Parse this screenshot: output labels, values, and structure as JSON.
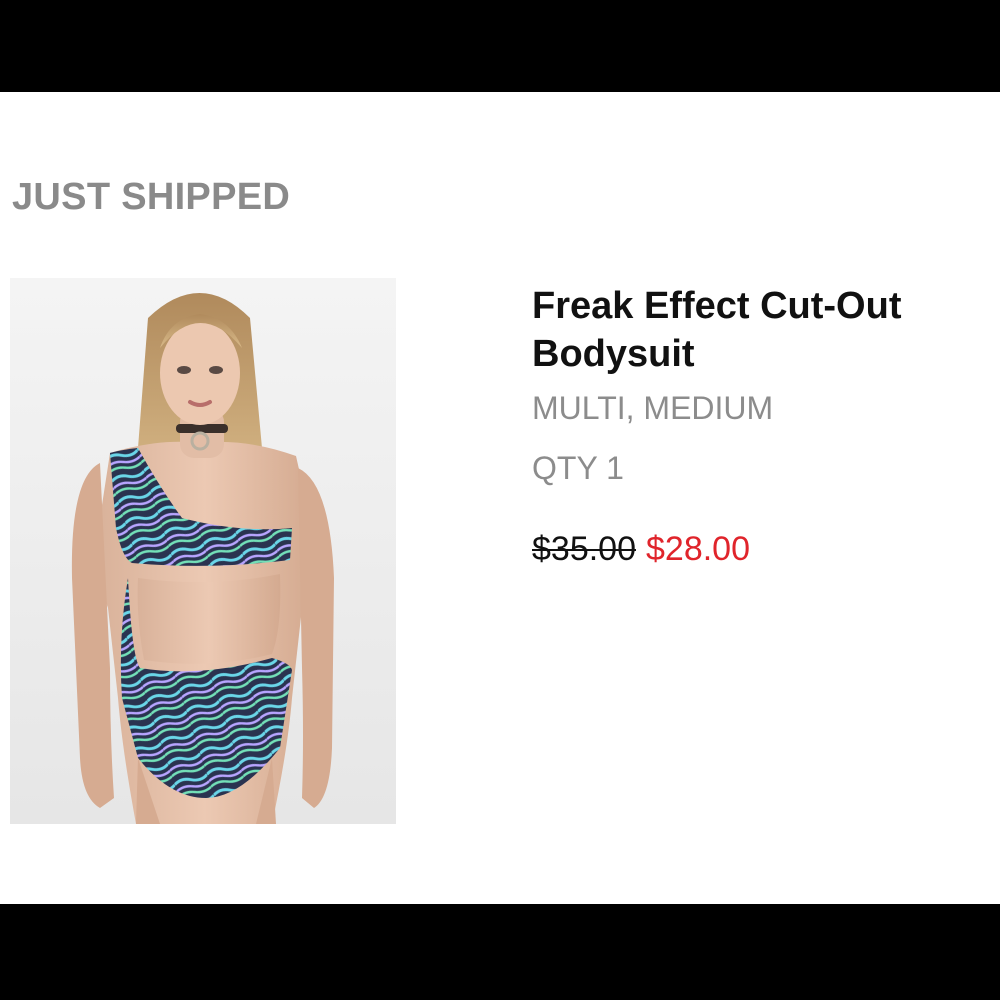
{
  "section": {
    "title": "JUST SHIPPED"
  },
  "product": {
    "name_line1": "Freak Effect Cut-Out",
    "name_line2": "Bodysuit",
    "variant": "MULTI, MEDIUM",
    "quantity": "QTY 1",
    "original_price": "$35.00",
    "sale_price": "$28.00"
  },
  "colors": {
    "sale_price": "#e0242b",
    "muted_text": "#8c8c8c",
    "letterbox": "#000000"
  }
}
